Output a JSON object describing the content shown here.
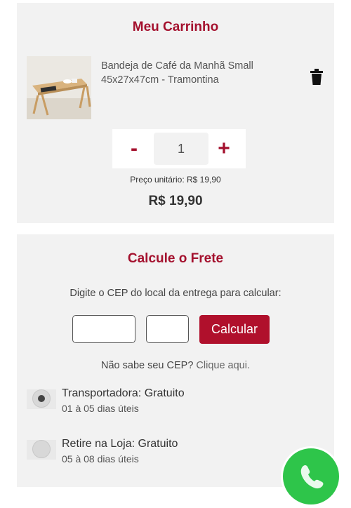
{
  "cart": {
    "title": "Meu Carrinho",
    "product_name": "Bandeja de Café da Manhã Small 45x27x47cm - Tramontina",
    "quantity": "1",
    "minus_label": "-",
    "plus_label": "+",
    "unit_price": "Preço unitário: R$ 19,90",
    "total_price": "R$ 19,90"
  },
  "shipping": {
    "title": "Calcule o Frete",
    "instructions": "Digite o CEP do local da entrega para calcular:",
    "cep_part1": "",
    "cep_part2": "",
    "calculate_label": "Calcular",
    "help_text": "Não sabe seu CEP?",
    "help_link": "Clique aqui.",
    "options": [
      {
        "title": "Transportadora: Gratuito",
        "subtitle": "01 à 05 dias úteis",
        "selected": true
      },
      {
        "title": "Retire na Loja: Gratuito",
        "subtitle": "05 à 08 dias úteis",
        "selected": false
      }
    ]
  },
  "icons": {
    "trash": "trash-icon",
    "whatsapp": "whatsapp-icon"
  },
  "colors": {
    "accent": "#a4112e",
    "button": "#b0102c",
    "card_bg": "#f2f2f2",
    "whatsapp": "#2ec54a"
  }
}
